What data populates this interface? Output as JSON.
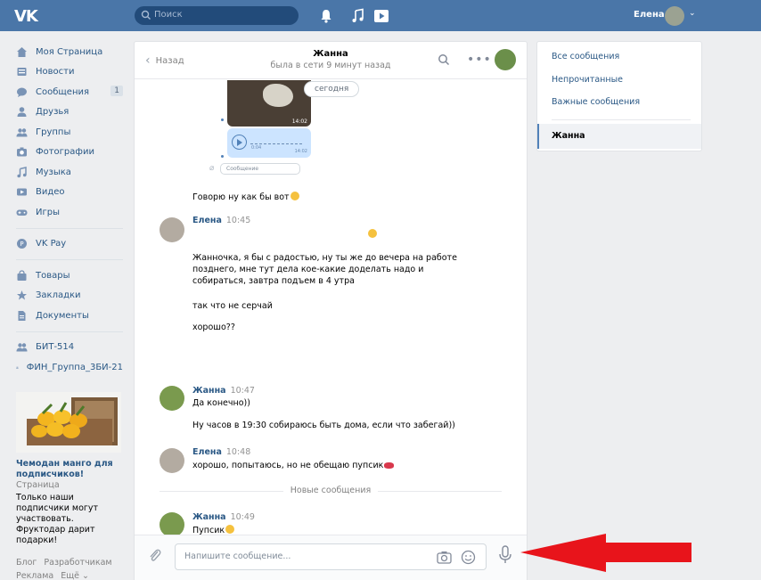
{
  "header": {
    "logo": "VK",
    "search_placeholder": "Поиск",
    "user_name": "Елена",
    "chevron": "⌄"
  },
  "sidebar": {
    "items": [
      {
        "label": "Моя Страница",
        "icon": "home-icon"
      },
      {
        "label": "Новости",
        "icon": "news-icon"
      },
      {
        "label": "Сообщения",
        "icon": "messages-icon",
        "badge": "1"
      },
      {
        "label": "Друзья",
        "icon": "friends-icon"
      },
      {
        "label": "Группы",
        "icon": "groups-icon"
      },
      {
        "label": "Фотографии",
        "icon": "photos-icon"
      },
      {
        "label": "Музыка",
        "icon": "music-icon"
      },
      {
        "label": "Видео",
        "icon": "video-icon"
      },
      {
        "label": "Игры",
        "icon": "games-icon"
      }
    ],
    "pay": {
      "label": "VK Pay",
      "icon": "vkpay-icon"
    },
    "items2": [
      {
        "label": "Товары",
        "icon": "goods-icon"
      },
      {
        "label": "Закладки",
        "icon": "bookmarks-icon"
      },
      {
        "label": "Документы",
        "icon": "documents-icon"
      }
    ],
    "groups": [
      {
        "label": "БИТ-514",
        "icon": "group-icon"
      },
      {
        "label": "ФИН_Группа_3БИ-21",
        "icon": "group-icon"
      }
    ]
  },
  "ad": {
    "title": "Чемодан манго для подписчиков!",
    "subtitle": "Страница",
    "description": "Только наши подписчики могут участвовать. Фруктодар дарит подарки!"
  },
  "footer": {
    "links": [
      "Блог",
      "Разработчикам",
      "Реклама",
      "Ещё ⌄"
    ]
  },
  "chat": {
    "back_label": "Назад",
    "title": "Жанна",
    "status": "была в сети 9 минут назад",
    "date_pill": "сегодня",
    "voice_time_start": "0:04",
    "voice_time_end": "14:02",
    "image_stamp": "14:02",
    "mini_placeholder": "Сообщение",
    "messages": [
      {
        "author": "",
        "time": "",
        "lines": [
          "Говорю ну как бы вот"
        ]
      },
      {
        "author": "Елена",
        "time": "10:45",
        "lines": [
          "Жанночка, я бы с радостью, ну ты же до вечера на работе позднего, мне тут дела кое-какие доделать надо и собираться, завтра подъем в 4 утра",
          "так что не серчай",
          "хорошо??"
        ]
      },
      {
        "author": "Жанна",
        "time": "10:47",
        "lines": [
          "Да конечно))",
          "Ну часов в 19:30 собираюсь быть дома, если что забегай))"
        ]
      },
      {
        "author": "Елена",
        "time": "10:48",
        "lines": [
          "хорошо, попытаюсь, но не обещаю пупсик"
        ]
      },
      {
        "author": "Жанна",
        "time": "10:49",
        "lines": [
          "Пупсик"
        ]
      }
    ],
    "new_messages_label": "Новые сообщения",
    "compose_placeholder": "Напишите сообщение..."
  },
  "right_menu": {
    "items": [
      "Все сообщения",
      "Непрочитанные",
      "Важные сообщения"
    ],
    "active": "Жанна"
  },
  "colors": {
    "header": "#4a76a8",
    "link": "#2a5885",
    "annotation_arrow": "#e8141b"
  }
}
